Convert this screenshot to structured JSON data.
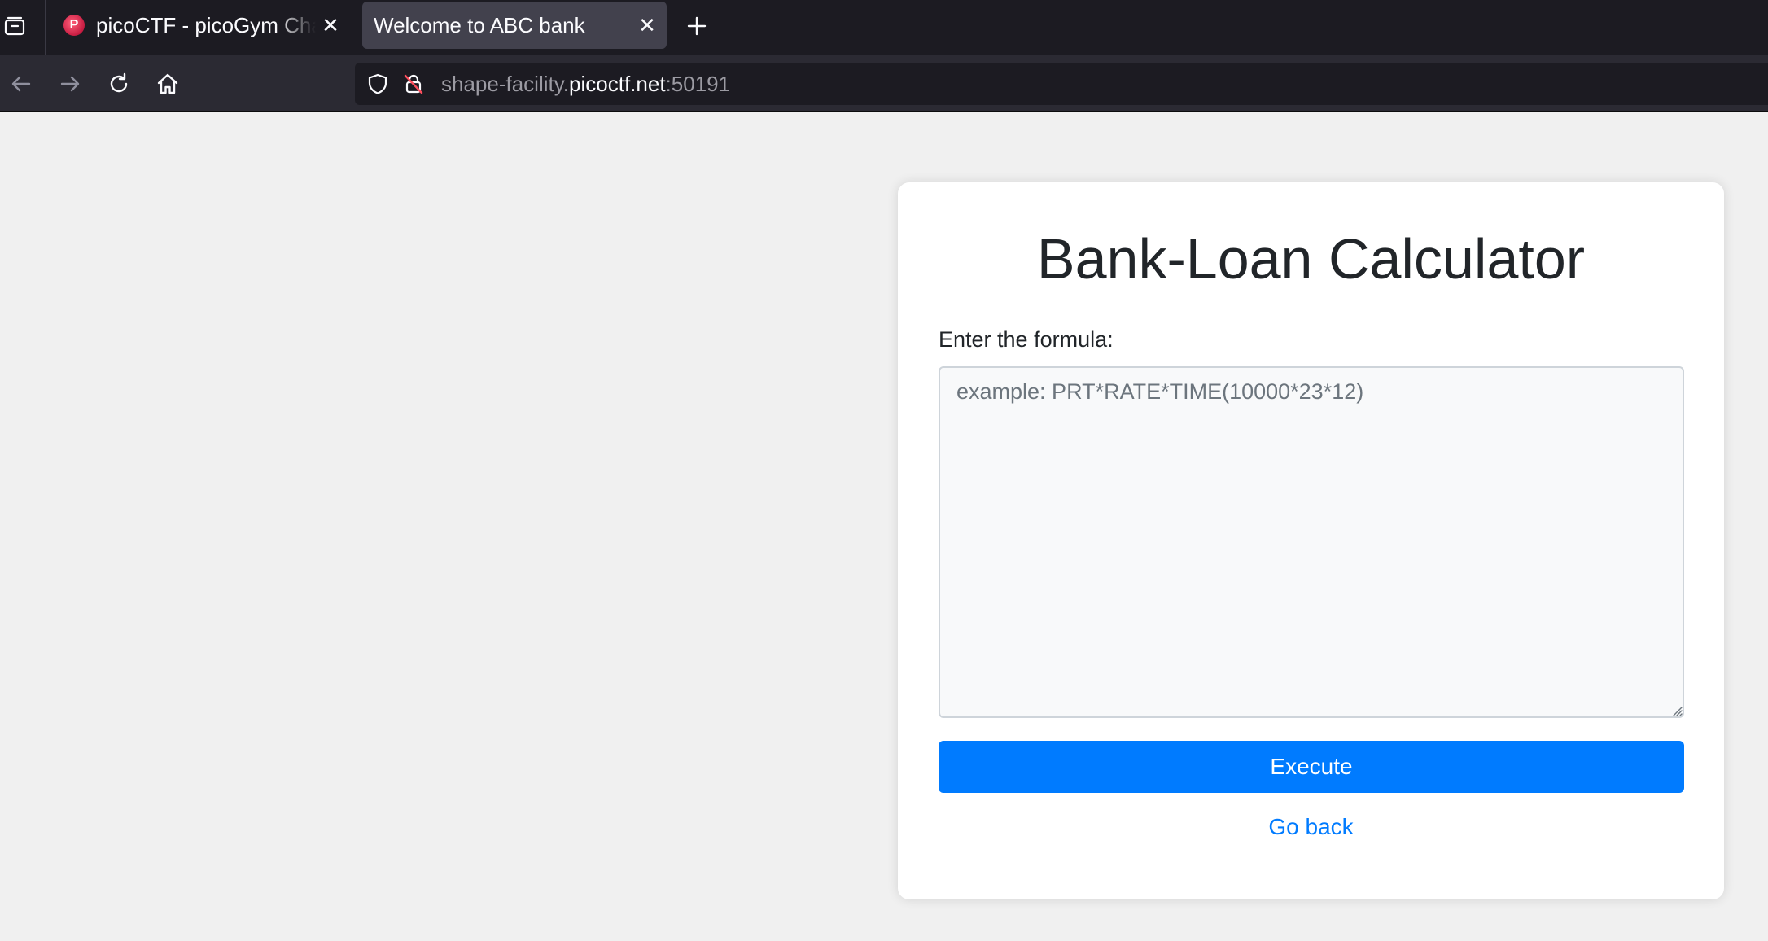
{
  "browser": {
    "tabs": [
      {
        "title": "picoCTF - picoGym Challenges",
        "favicon": "picoctf-logo",
        "active": false
      },
      {
        "title": "Welcome to ABC bank",
        "active": true
      }
    ],
    "url": {
      "subdomain": "shape-facility.",
      "domain": "picoctf.net",
      "port": ":50191"
    },
    "icons": {
      "tab_overview": "tab-overview-icon",
      "back": "back-arrow-icon",
      "forward": "forward-arrow-icon",
      "reload": "reload-icon",
      "home": "home-icon",
      "tracking_protection": "shield-icon",
      "insecure_lock": "insecure-lock-icon",
      "close": "close-icon",
      "new_tab": "plus-icon"
    }
  },
  "page": {
    "title": "Bank-Loan Calculator",
    "formula_label": "Enter the formula:",
    "formula_value": "",
    "formula_placeholder": "example: PRT*RATE*TIME(10000*23*12)",
    "execute_label": "Execute",
    "go_back_label": "Go back"
  },
  "colors": {
    "primary": "#007bff",
    "page_background": "#f0f0f0",
    "card_background": "#ffffff",
    "browser_chrome": "#1c1b22"
  }
}
